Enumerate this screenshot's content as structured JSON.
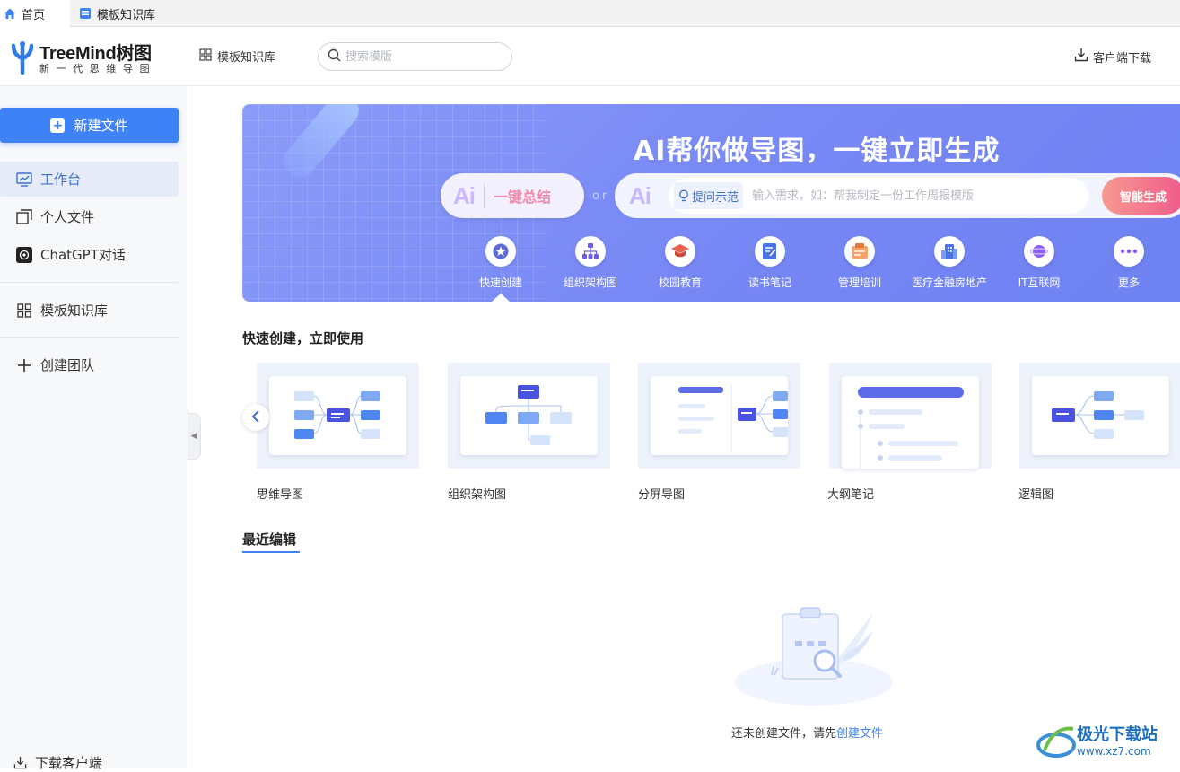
{
  "tabs": [
    {
      "label": "首页",
      "icon": "home-icon"
    },
    {
      "label": "模板知识库",
      "icon": "template-icon"
    }
  ],
  "header": {
    "logo_name": "TreeMind树图",
    "logo_tagline": "新一代思维导图",
    "template_link": "模板知识库",
    "search_placeholder": "搜索模版",
    "download_client": "客户端下载"
  },
  "sidebar": {
    "new_file": "新建文件",
    "items": [
      {
        "label": "工作台",
        "icon": "dashboard-icon",
        "active": true
      },
      {
        "label": "个人文件",
        "icon": "files-icon"
      },
      {
        "label": "ChatGPT对话",
        "icon": "chatgpt-icon"
      },
      {
        "label": "模板知识库",
        "icon": "grid-icon"
      },
      {
        "label": "创建团队",
        "icon": "plus-icon"
      }
    ],
    "download_client": "下载客户端"
  },
  "banner": {
    "title": "AI帮你做导图，一键立即生成",
    "ai_mark": "Ai",
    "ai_summary": "一键总结",
    "or": "or",
    "hint_chip": "提问示范",
    "input_placeholder": "输入需求，如：帮我制定一份工作周报模版",
    "generate_button": "智能生成",
    "categories": [
      {
        "label": "快速创建",
        "icon": "star-icon"
      },
      {
        "label": "组织架构图",
        "icon": "org-chart-icon"
      },
      {
        "label": "校园教育",
        "icon": "graduation-cap-icon"
      },
      {
        "label": "读书笔记",
        "icon": "notebook-icon"
      },
      {
        "label": "管理培训",
        "icon": "training-icon"
      },
      {
        "label": "医疗金融房地产",
        "icon": "building-icon"
      },
      {
        "label": "IT互联网",
        "icon": "internet-icon"
      },
      {
        "label": "更多",
        "icon": "more-icon"
      }
    ]
  },
  "quick_create": {
    "title": "快速创建，立即使用",
    "cards": [
      {
        "label": "思维导图"
      },
      {
        "label": "组织架构图"
      },
      {
        "label": "分屏导图"
      },
      {
        "label": "大纲笔记"
      },
      {
        "label": "逻辑图"
      }
    ]
  },
  "recent": {
    "title": "最近编辑",
    "empty_prefix": "还未创建文件，请先",
    "empty_link": "创建文件"
  },
  "watermark": {
    "name": "极光下载站",
    "url": "www.xz7.com"
  },
  "colors": {
    "accent": "#3f82f6",
    "banner": "#7888f5",
    "generate": "#f05a8a"
  }
}
